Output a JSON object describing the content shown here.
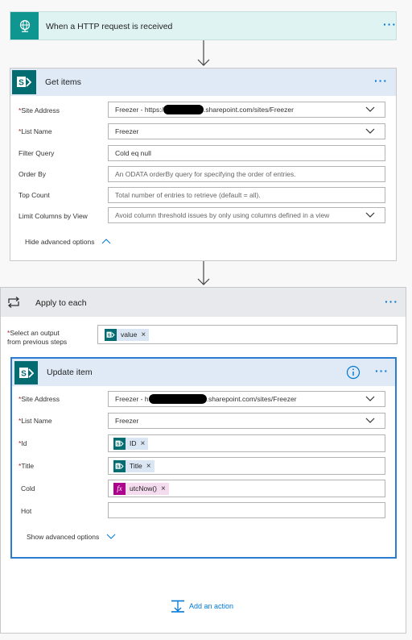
{
  "trigger": {
    "title": "When a HTTP request is received"
  },
  "get_items": {
    "title": "Get items",
    "fields": [
      {
        "label": "Site Address",
        "required": true,
        "value": "Freezer - https:/",
        "value_suffix": ".sharepoint.com/sites/Freezer",
        "dropdown": true
      },
      {
        "label": "List Name",
        "required": true,
        "value": "Freezer",
        "dropdown": true
      },
      {
        "label": "Filter Query",
        "required": false,
        "value": "Cold eq null"
      },
      {
        "label": "Order By",
        "required": false,
        "placeholder": "An ODATA orderBy query for specifying the order of entries."
      },
      {
        "label": "Top Count",
        "required": false,
        "placeholder": "Total number of entries to retrieve (default = all)."
      },
      {
        "label": "Limit Columns by View",
        "required": false,
        "placeholder": "Avoid column threshold issues by only using columns defined in a view",
        "dropdown": true
      }
    ],
    "toggle_label": "Hide advanced options"
  },
  "apply_each": {
    "title": "Apply to each",
    "select_label_line1": "Select an output",
    "select_label_line2": "from previous steps",
    "token": "value"
  },
  "update_item": {
    "title": "Update item",
    "site_label": "Site Address",
    "site_value": "Freezer - h",
    "site_suffix": ".sharepoint.com/sites/Freezer",
    "list_label": "List Name",
    "list_value": "Freezer",
    "id_label": "Id",
    "id_token": "ID",
    "title_label": "Title",
    "title_token": "Title",
    "cold_label": "Cold",
    "cold_token": "utcNow()",
    "hot_label": "Hot",
    "toggle_label": "Show advanced options"
  },
  "add_action": {
    "label": "Add an action"
  },
  "icons": {
    "globe": "globe-icon",
    "sharepoint": "sharepoint-icon",
    "loop": "loop-icon",
    "info": "info-icon",
    "fx": "fx-icon",
    "more": "more-icon"
  },
  "colors": {
    "trigger_bg": "#e0f3f3",
    "trigger_icon": "#0f9690",
    "sp_green": "#036c70",
    "header_blue": "#dfeaf6",
    "accent": "#0078d4",
    "fx": "#ad008c"
  }
}
